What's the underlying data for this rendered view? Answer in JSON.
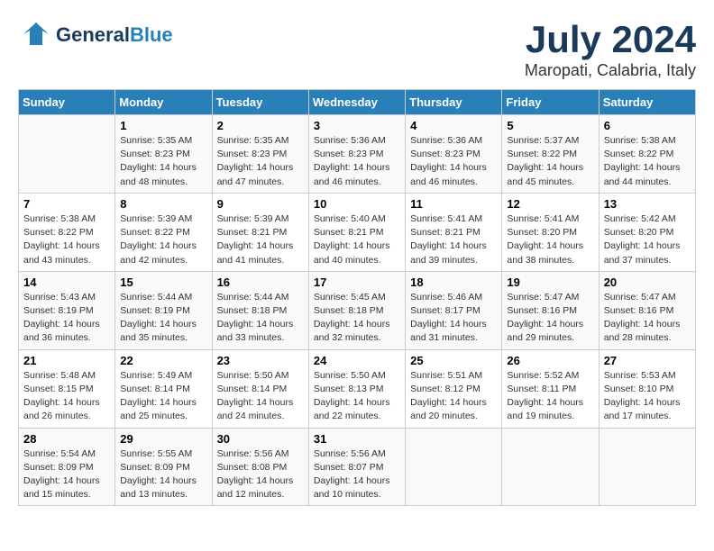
{
  "header": {
    "logo_general": "General",
    "logo_blue": "Blue",
    "title": "July 2024",
    "subtitle": "Maropati, Calabria, Italy"
  },
  "weekdays": [
    "Sunday",
    "Monday",
    "Tuesday",
    "Wednesday",
    "Thursday",
    "Friday",
    "Saturday"
  ],
  "weeks": [
    [
      {
        "day": "",
        "info": ""
      },
      {
        "day": "1",
        "info": "Sunrise: 5:35 AM\nSunset: 8:23 PM\nDaylight: 14 hours\nand 48 minutes."
      },
      {
        "day": "2",
        "info": "Sunrise: 5:35 AM\nSunset: 8:23 PM\nDaylight: 14 hours\nand 47 minutes."
      },
      {
        "day": "3",
        "info": "Sunrise: 5:36 AM\nSunset: 8:23 PM\nDaylight: 14 hours\nand 46 minutes."
      },
      {
        "day": "4",
        "info": "Sunrise: 5:36 AM\nSunset: 8:23 PM\nDaylight: 14 hours\nand 46 minutes."
      },
      {
        "day": "5",
        "info": "Sunrise: 5:37 AM\nSunset: 8:22 PM\nDaylight: 14 hours\nand 45 minutes."
      },
      {
        "day": "6",
        "info": "Sunrise: 5:38 AM\nSunset: 8:22 PM\nDaylight: 14 hours\nand 44 minutes."
      }
    ],
    [
      {
        "day": "7",
        "info": "Sunrise: 5:38 AM\nSunset: 8:22 PM\nDaylight: 14 hours\nand 43 minutes."
      },
      {
        "day": "8",
        "info": "Sunrise: 5:39 AM\nSunset: 8:22 PM\nDaylight: 14 hours\nand 42 minutes."
      },
      {
        "day": "9",
        "info": "Sunrise: 5:39 AM\nSunset: 8:21 PM\nDaylight: 14 hours\nand 41 minutes."
      },
      {
        "day": "10",
        "info": "Sunrise: 5:40 AM\nSunset: 8:21 PM\nDaylight: 14 hours\nand 40 minutes."
      },
      {
        "day": "11",
        "info": "Sunrise: 5:41 AM\nSunset: 8:21 PM\nDaylight: 14 hours\nand 39 minutes."
      },
      {
        "day": "12",
        "info": "Sunrise: 5:41 AM\nSunset: 8:20 PM\nDaylight: 14 hours\nand 38 minutes."
      },
      {
        "day": "13",
        "info": "Sunrise: 5:42 AM\nSunset: 8:20 PM\nDaylight: 14 hours\nand 37 minutes."
      }
    ],
    [
      {
        "day": "14",
        "info": "Sunrise: 5:43 AM\nSunset: 8:19 PM\nDaylight: 14 hours\nand 36 minutes."
      },
      {
        "day": "15",
        "info": "Sunrise: 5:44 AM\nSunset: 8:19 PM\nDaylight: 14 hours\nand 35 minutes."
      },
      {
        "day": "16",
        "info": "Sunrise: 5:44 AM\nSunset: 8:18 PM\nDaylight: 14 hours\nand 33 minutes."
      },
      {
        "day": "17",
        "info": "Sunrise: 5:45 AM\nSunset: 8:18 PM\nDaylight: 14 hours\nand 32 minutes."
      },
      {
        "day": "18",
        "info": "Sunrise: 5:46 AM\nSunset: 8:17 PM\nDaylight: 14 hours\nand 31 minutes."
      },
      {
        "day": "19",
        "info": "Sunrise: 5:47 AM\nSunset: 8:16 PM\nDaylight: 14 hours\nand 29 minutes."
      },
      {
        "day": "20",
        "info": "Sunrise: 5:47 AM\nSunset: 8:16 PM\nDaylight: 14 hours\nand 28 minutes."
      }
    ],
    [
      {
        "day": "21",
        "info": "Sunrise: 5:48 AM\nSunset: 8:15 PM\nDaylight: 14 hours\nand 26 minutes."
      },
      {
        "day": "22",
        "info": "Sunrise: 5:49 AM\nSunset: 8:14 PM\nDaylight: 14 hours\nand 25 minutes."
      },
      {
        "day": "23",
        "info": "Sunrise: 5:50 AM\nSunset: 8:14 PM\nDaylight: 14 hours\nand 24 minutes."
      },
      {
        "day": "24",
        "info": "Sunrise: 5:50 AM\nSunset: 8:13 PM\nDaylight: 14 hours\nand 22 minutes."
      },
      {
        "day": "25",
        "info": "Sunrise: 5:51 AM\nSunset: 8:12 PM\nDaylight: 14 hours\nand 20 minutes."
      },
      {
        "day": "26",
        "info": "Sunrise: 5:52 AM\nSunset: 8:11 PM\nDaylight: 14 hours\nand 19 minutes."
      },
      {
        "day": "27",
        "info": "Sunrise: 5:53 AM\nSunset: 8:10 PM\nDaylight: 14 hours\nand 17 minutes."
      }
    ],
    [
      {
        "day": "28",
        "info": "Sunrise: 5:54 AM\nSunset: 8:09 PM\nDaylight: 14 hours\nand 15 minutes."
      },
      {
        "day": "29",
        "info": "Sunrise: 5:55 AM\nSunset: 8:09 PM\nDaylight: 14 hours\nand 13 minutes."
      },
      {
        "day": "30",
        "info": "Sunrise: 5:56 AM\nSunset: 8:08 PM\nDaylight: 14 hours\nand 12 minutes."
      },
      {
        "day": "31",
        "info": "Sunrise: 5:56 AM\nSunset: 8:07 PM\nDaylight: 14 hours\nand 10 minutes."
      },
      {
        "day": "",
        "info": ""
      },
      {
        "day": "",
        "info": ""
      },
      {
        "day": "",
        "info": ""
      }
    ]
  ]
}
